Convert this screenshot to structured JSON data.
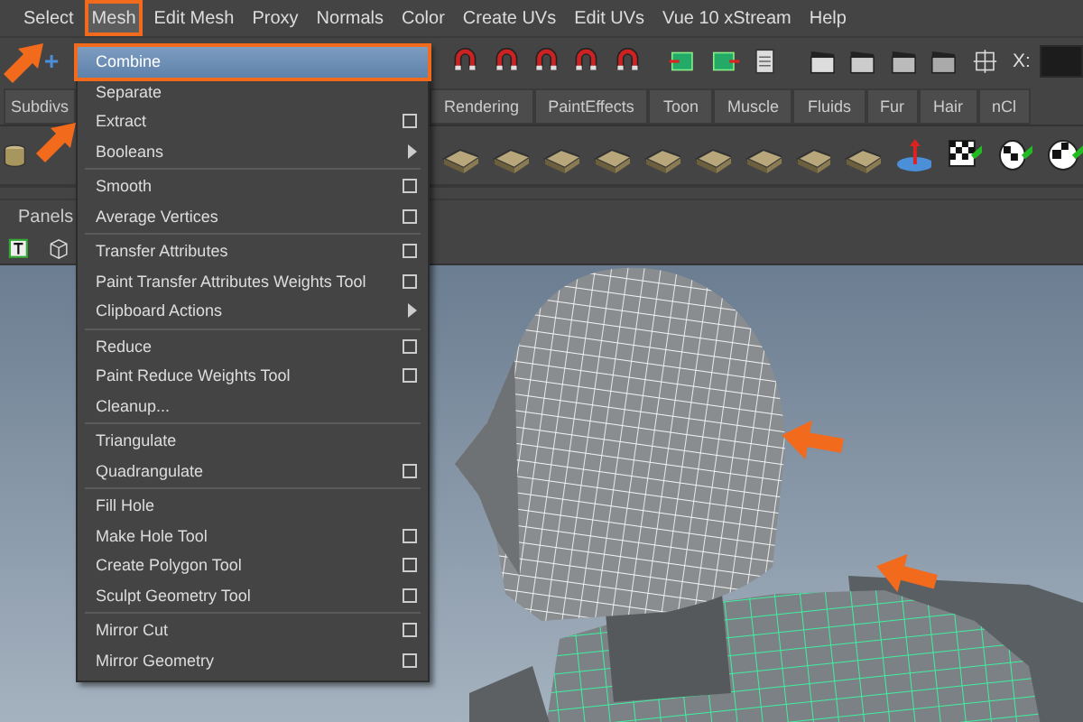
{
  "menu_bar": [
    {
      "label": "Select",
      "selected": false
    },
    {
      "label": "Mesh",
      "selected": true
    },
    {
      "label": "Edit Mesh",
      "selected": false
    },
    {
      "label": "Proxy",
      "selected": false
    },
    {
      "label": "Normals",
      "selected": false
    },
    {
      "label": "Color",
      "selected": false
    },
    {
      "label": "Create UVs",
      "selected": false
    },
    {
      "label": "Edit UVs",
      "selected": false
    },
    {
      "label": "Vue 10 xStream",
      "selected": false
    },
    {
      "label": "Help",
      "selected": false
    }
  ],
  "toolbar": {
    "field_label": "X:"
  },
  "shelf_tabs": [
    {
      "label": "Subdivs"
    },
    {
      "label": "Rendering"
    },
    {
      "label": "PaintEffects"
    },
    {
      "label": "Toon"
    },
    {
      "label": "Muscle"
    },
    {
      "label": "Fluids"
    },
    {
      "label": "Fur"
    },
    {
      "label": "Hair"
    },
    {
      "label": "nCl"
    }
  ],
  "panel_bar": {
    "label": "Panels"
  },
  "mesh_menu": {
    "sections": [
      [
        {
          "label": "Combine",
          "kind": "plain",
          "selected": true
        },
        {
          "label": "Separate",
          "kind": "plain",
          "selected": false
        },
        {
          "label": "Extract",
          "kind": "option",
          "selected": false
        },
        {
          "label": "Booleans",
          "kind": "submenu",
          "selected": false
        }
      ],
      [
        {
          "label": "Smooth",
          "kind": "option",
          "selected": false
        },
        {
          "label": "Average Vertices",
          "kind": "option",
          "selected": false
        }
      ],
      [
        {
          "label": "Transfer Attributes",
          "kind": "option",
          "selected": false
        },
        {
          "label": "Paint Transfer Attributes Weights Tool",
          "kind": "option",
          "selected": false
        },
        {
          "label": "Clipboard Actions",
          "kind": "submenu",
          "selected": false
        }
      ],
      [
        {
          "label": "Reduce",
          "kind": "option",
          "selected": false
        },
        {
          "label": "Paint Reduce Weights Tool",
          "kind": "option",
          "selected": false
        },
        {
          "label": "Cleanup...",
          "kind": "plain",
          "selected": false
        }
      ],
      [
        {
          "label": "Triangulate",
          "kind": "plain",
          "selected": false
        },
        {
          "label": "Quadrangulate",
          "kind": "option",
          "selected": false
        }
      ],
      [
        {
          "label": "Fill Hole",
          "kind": "plain",
          "selected": false
        },
        {
          "label": "Make Hole Tool",
          "kind": "option",
          "selected": false
        },
        {
          "label": "Create Polygon Tool",
          "kind": "option",
          "selected": false
        },
        {
          "label": "Sculpt Geometry Tool",
          "kind": "option",
          "selected": false
        }
      ],
      [
        {
          "label": "Mirror Cut",
          "kind": "option",
          "selected": false
        },
        {
          "label": "Mirror Geometry",
          "kind": "option",
          "selected": false
        }
      ]
    ]
  }
}
